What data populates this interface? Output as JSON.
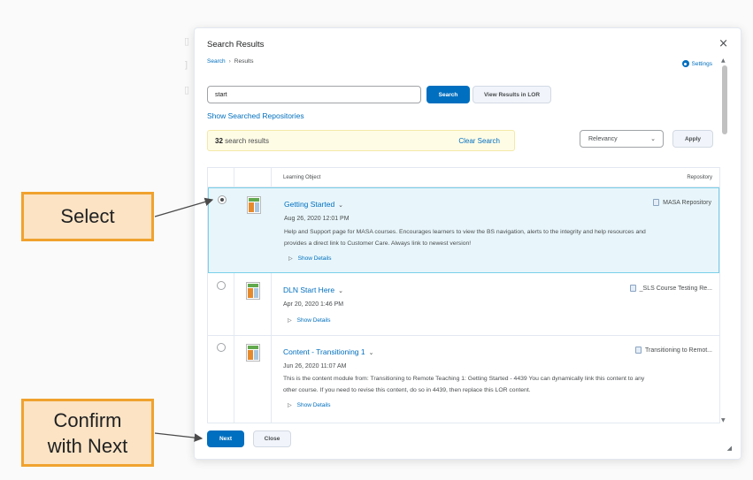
{
  "dialog": {
    "title": "Search Results",
    "close_glyph": "×",
    "breadcrumb": {
      "link": "Search",
      "separator": "›",
      "current": "Results"
    },
    "settings_label": "Settings"
  },
  "search": {
    "value": "start",
    "search_button": "Search",
    "view_lor_button": "View Results in LOR"
  },
  "show_repos_link": "Show Searched Repositories",
  "results": {
    "count": "32",
    "count_suffix": "search results",
    "clear_label": "Clear Search"
  },
  "sort": {
    "selected": "Relevancy",
    "apply_label": "Apply"
  },
  "table": {
    "headers": {
      "learning_object": "Learning Object",
      "repository": "Repository"
    },
    "rows": [
      {
        "title": "Getting Started",
        "date": "Aug 26, 2020 12:01 PM",
        "description": "Help and Support page for MASA courses. Encourages learners to view the BS navigation, alerts to the integrity and help resources and provides a direct link to Customer Care. Always link to newest version!",
        "show_details": "Show Details",
        "repository": "MASA Repository",
        "selected": true
      },
      {
        "title": "DLN Start Here",
        "date": "Apr 20, 2020 1:46 PM",
        "description": "",
        "show_details": "Show Details",
        "repository": "_SLS Course Testing Re...",
        "selected": false
      },
      {
        "title": "Content - Transitioning 1",
        "date": "Jun 26, 2020 11:07 AM",
        "description": "This is the content module from: Transitioning to Remote Teaching 1: Getting Started - 4439 You can dynamically link this content to any other course. If you need to revise this content, do so in 4439, then replace this LOR content.",
        "show_details": "Show Details",
        "repository": "Transitioning to Remot...",
        "selected": false
      }
    ]
  },
  "footer": {
    "next_label": "Next",
    "close_label": "Close"
  },
  "callouts": {
    "select": "Select",
    "confirm_line1": "Confirm",
    "confirm_line2": "with Next"
  },
  "colors": {
    "accent": "#006fbf",
    "callout_fill": "#fbe3c4",
    "callout_border": "#f0a22e",
    "selected_row": "#e8f6fb",
    "results_bar": "#fffce6"
  }
}
